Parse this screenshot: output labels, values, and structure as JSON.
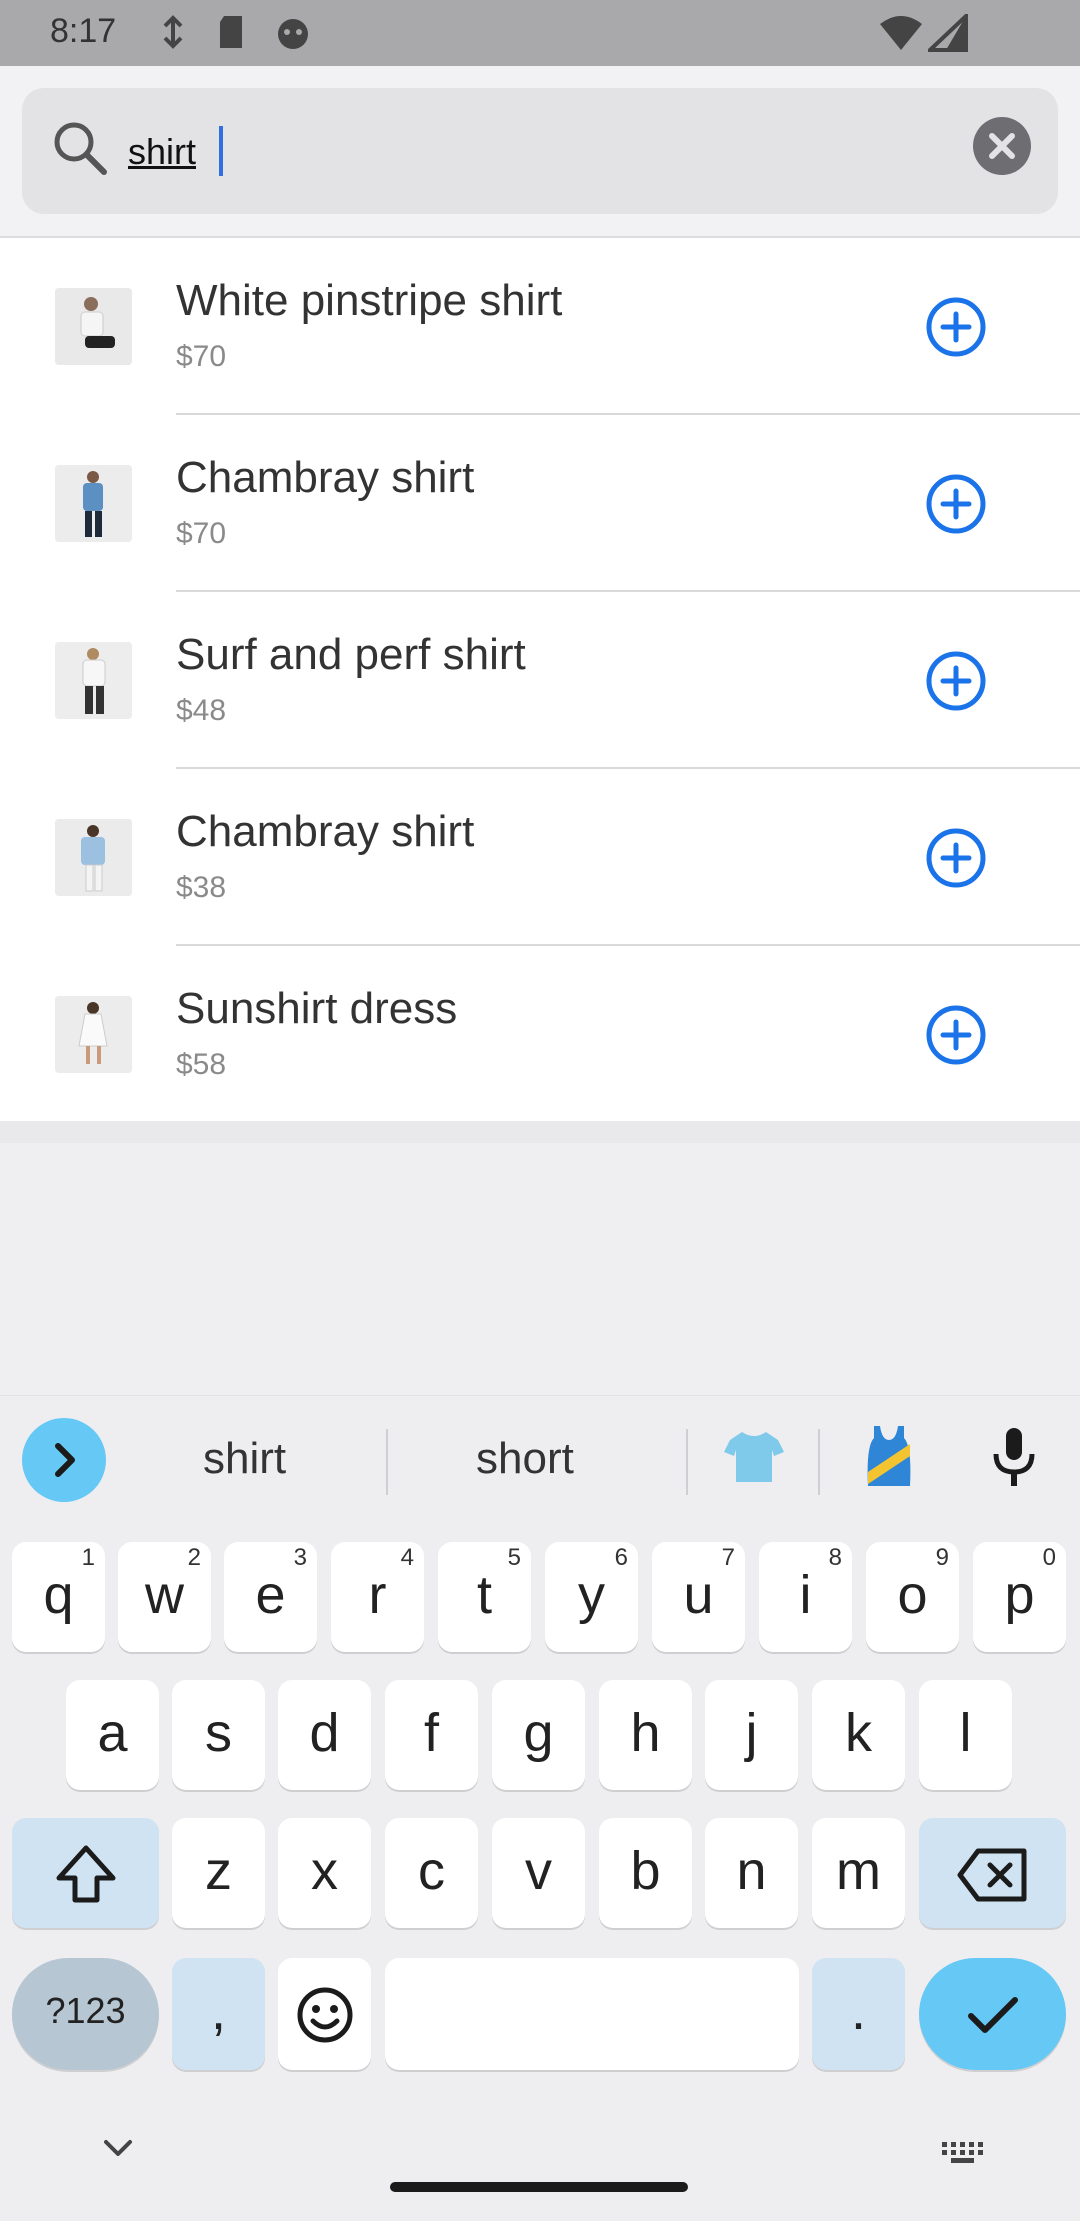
{
  "status": {
    "time": "8:17"
  },
  "search": {
    "value": "shirt",
    "icon": "search-icon",
    "clear_icon": "close-icon"
  },
  "results": [
    {
      "name": "White pinstripe shirt",
      "price": "$70"
    },
    {
      "name": "Chambray shirt",
      "price": "$70"
    },
    {
      "name": "Surf and perf shirt",
      "price": "$48"
    },
    {
      "name": "Chambray shirt",
      "price": "$38"
    },
    {
      "name": "Sunshirt dress",
      "price": "$58"
    }
  ],
  "keyboard": {
    "suggestions": [
      "shirt",
      "short"
    ],
    "row1": [
      {
        "key": "q",
        "hint": "1"
      },
      {
        "key": "w",
        "hint": "2"
      },
      {
        "key": "e",
        "hint": "3"
      },
      {
        "key": "r",
        "hint": "4"
      },
      {
        "key": "t",
        "hint": "5"
      },
      {
        "key": "y",
        "hint": "6"
      },
      {
        "key": "u",
        "hint": "7"
      },
      {
        "key": "i",
        "hint": "8"
      },
      {
        "key": "o",
        "hint": "9"
      },
      {
        "key": "p",
        "hint": "0"
      }
    ],
    "row2": [
      "a",
      "s",
      "d",
      "f",
      "g",
      "h",
      "j",
      "k",
      "l"
    ],
    "row3": [
      "z",
      "x",
      "c",
      "v",
      "b",
      "n",
      "m"
    ],
    "symbols_label": "?123",
    "comma": ",",
    "period": "."
  },
  "colors": {
    "accent": "#1a73e8",
    "keyboard_action": "#66c8f4"
  }
}
